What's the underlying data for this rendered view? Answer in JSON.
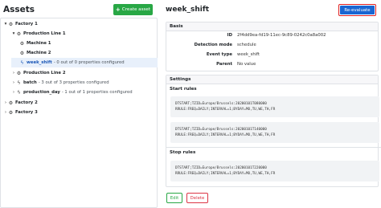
{
  "assets": {
    "title": "Assets",
    "create_label": "Create asset",
    "tree": [
      {
        "label": "Factory 1",
        "desc": "",
        "chevron": "▾",
        "icon": "factory-icon"
      },
      {
        "label": "Production Line 1",
        "desc": "",
        "chevron": "▾",
        "icon": "factory-icon"
      },
      {
        "label": "Machine 1",
        "desc": "",
        "chevron": "",
        "icon": "factory-icon"
      },
      {
        "label": "Machine 2",
        "desc": "",
        "chevron": "",
        "icon": "factory-icon"
      },
      {
        "label": "week_shift",
        "desc": "- 0 out of 0 properties configured",
        "chevron": "",
        "icon": "bolt-icon"
      },
      {
        "label": "Production Line 2",
        "desc": "",
        "chevron": "›",
        "icon": "factory-icon"
      },
      {
        "label": "batch",
        "desc": "- 3 out of 3 properties configured",
        "chevron": "›",
        "icon": "bolt-icon"
      },
      {
        "label": "production_day",
        "desc": "- 1 out of 1 properties configured",
        "chevron": "›",
        "icon": "bolt-icon"
      },
      {
        "label": "Factory 2",
        "desc": "",
        "chevron": "›",
        "icon": "factory-icon"
      },
      {
        "label": "Factory 3",
        "desc": "",
        "chevron": "›",
        "icon": "factory-icon"
      }
    ]
  },
  "detail": {
    "title": "week_shift",
    "reevaluate_label": "Re-evaluate",
    "basis": {
      "header": "Basis",
      "fields": [
        {
          "key": "ID",
          "value": "2f4dd9ea-fd19-11ec-9c89-0242c0a8a002"
        },
        {
          "key": "Detection mode",
          "value": "schedule"
        },
        {
          "key": "Event type",
          "value": "week_shift"
        },
        {
          "key": "Parent",
          "value": "No value"
        }
      ]
    },
    "settings": {
      "header": "Settings",
      "start_rules_label": "Start rules",
      "start_rules": [
        "DTSTART;TZID=Europe/Brussels:20200101T080000\nRRULE:FREQ=DAILY;INTERVAL=1;BYDAY=MO,TU,WE,TH,FR",
        "DTSTART;TZID=Europe/Brussels:20200101T140000\nRRULE:FREQ=DAILY;INTERVAL=1;BYDAY=MO,TU,WE,TH,FR"
      ],
      "stop_rules_label": "Stop rules",
      "stop_rules": [
        "DTSTART;TZID=Europe/Brussels:20200101T220000\nRRULE:FREQ=DAILY;INTERVAL=1;BYDAY=MO,TU,WE,TH,FR"
      ]
    },
    "edit_label": "Edit",
    "delete_label": "Delete"
  }
}
